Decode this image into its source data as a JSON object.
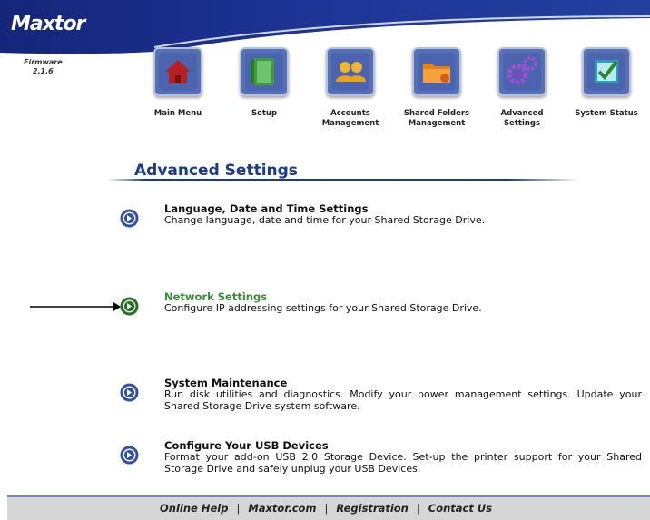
{
  "brand": {
    "logo": "Maxtor",
    "firmware_label": "Firmware",
    "firmware_version": "2.1.6"
  },
  "nav": [
    {
      "label": "Main Menu",
      "icon": "house-icon",
      "color": "#b22222"
    },
    {
      "label": "Setup",
      "icon": "setup-panel-icon",
      "color": "#3a9d3a"
    },
    {
      "label": "Accounts Management",
      "icon": "users-icon",
      "color": "#e8a317"
    },
    {
      "label": "Shared Folders Management",
      "icon": "shared-folders-icon",
      "color": "#e8801a"
    },
    {
      "label": "Advanced Settings",
      "icon": "gears-icon",
      "color": "#8a3fbf"
    },
    {
      "label": "System Status",
      "icon": "checkmark-icon",
      "color": "#2a9fb8"
    }
  ],
  "page": {
    "title": "Advanced Settings"
  },
  "entries": [
    {
      "title": "Language, Date and Time Settings",
      "description": "Change language, date and time for your Shared Storage Drive."
    },
    {
      "title": "Network Settings",
      "description": "Configure IP addressing settings for your Shared Storage Drive."
    },
    {
      "title": "System Maintenance",
      "description": "Run disk utilities and diagnostics. Modify your power management settings. Update your Shared Storage Drive system software."
    },
    {
      "title": "Configure Your USB Devices",
      "description": "Format your add-on USB 2.0 Storage Device. Set-up the printer support for your Shared Storage Drive and safely unplug your USB Devices."
    }
  ],
  "footer": {
    "links": [
      "Online Help",
      "Maxtor.com",
      "Registration",
      "Contact Us"
    ]
  },
  "colors": {
    "header_blue": "#1b2f8c",
    "title_blue": "#1a3a8f",
    "active_green": "#3d8a3a",
    "bullet_blue": "#2f4fae"
  }
}
